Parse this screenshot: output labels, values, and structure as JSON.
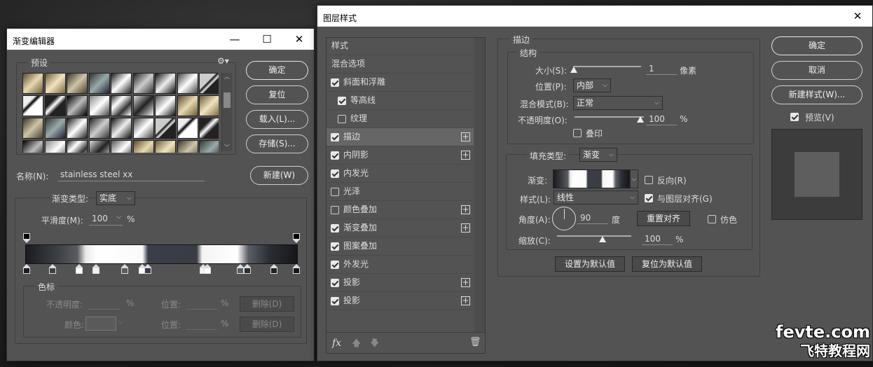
{
  "gradient_editor": {
    "title": "渐变编辑器",
    "controls": {
      "minimize": "—",
      "maximize": "☐",
      "close": "✕"
    },
    "presets_label": "预设",
    "buttons": {
      "ok": "确定",
      "reset": "复位",
      "load": "载入(L)...",
      "save": "存储(S)...",
      "new": "新建(W)"
    },
    "name_label": "名称(N):",
    "name_value": "stainless steel xx",
    "gradient_type_label": "渐变类型:",
    "gradient_type_value": "实底",
    "smoothness_label": "平滑度(M):",
    "smoothness_value": "100",
    "percent": "%",
    "color_stop_group": "色标",
    "opacity_label": "不透明度:",
    "location_label": "位置:",
    "delete_label": "删除(D)",
    "color_label": "颜色:"
  },
  "layer_style": {
    "title": "图层样式",
    "close": "✕",
    "list_header": "样式",
    "blend_options": "混合选项",
    "items": [
      {
        "label": "斜面和浮雕",
        "checked": true,
        "plus": false
      },
      {
        "label": "等高线",
        "checked": true,
        "plus": false,
        "indent": true
      },
      {
        "label": "纹理",
        "checked": false,
        "plus": false,
        "indent": true
      },
      {
        "label": "描边",
        "checked": true,
        "plus": true,
        "selected": true
      },
      {
        "label": "内阴影",
        "checked": true,
        "plus": true
      },
      {
        "label": "内发光",
        "checked": true,
        "plus": false
      },
      {
        "label": "光泽",
        "checked": false,
        "plus": false
      },
      {
        "label": "颜色叠加",
        "checked": false,
        "plus": true
      },
      {
        "label": "渐变叠加",
        "checked": true,
        "plus": true
      },
      {
        "label": "图案叠加",
        "checked": true,
        "plus": false
      },
      {
        "label": "外发光",
        "checked": true,
        "plus": false
      },
      {
        "label": "投影",
        "checked": true,
        "plus": true
      },
      {
        "label": "投影",
        "checked": true,
        "plus": true
      }
    ],
    "fx": "fx",
    "stroke_group": "描边",
    "structure_group": "结构",
    "size_label": "大小(S):",
    "size_value": "1",
    "size_unit": "像素",
    "position_label": "位置(P):",
    "position_value": "内部",
    "blend_mode_label": "混合模式(B):",
    "blend_mode_value": "正常",
    "opacity_label": "不透明度(O):",
    "opacity_value": "100",
    "percent": "%",
    "overprint_label": "叠印",
    "fill_type_label": "填充类型:",
    "fill_type_value": "渐变",
    "gradient_label": "渐变:",
    "reverse_label": "反向(R)",
    "style_label": "样式(L):",
    "style_value": "线性",
    "align_label": "与图层对齐(G)",
    "angle_label": "角度(A):",
    "angle_value": "90",
    "degree": "度",
    "reset_align": "重置对齐",
    "dither_label": "仿色",
    "scale_label": "缩放(C):",
    "scale_value": "100",
    "set_default": "设置为默认值",
    "reset_default": "复位为默认值",
    "ok": "确定",
    "cancel": "取消",
    "new_style": "新建样式(W)...",
    "preview_label": "预览(V)"
  },
  "watermark": {
    "line1": "fevte.com",
    "line2": "飞特教程网"
  }
}
